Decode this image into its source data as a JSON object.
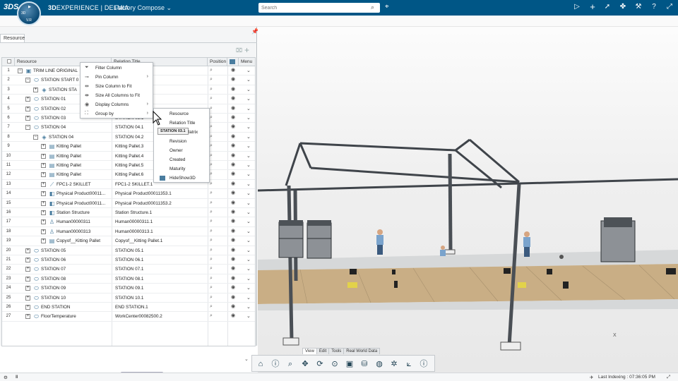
{
  "topbar": {
    "logo": "3DS",
    "compass_v": "V",
    "compass_r": "R",
    "compass_3d": "3D",
    "brand_prefix": "3D",
    "brand_main": "EXPERIENCE | DELMIA",
    "app_title": "Factory Compose",
    "search_placeholder": "Search",
    "icons": [
      "play-icon",
      "add-icon",
      "share-icon",
      "network-icon",
      "tools-icon",
      "help-icon",
      "expand-icon"
    ]
  },
  "panel": {
    "tab_label": "Resource",
    "columns": [
      "Resource",
      "Relation Title",
      "Position",
      "Menu"
    ],
    "rows": [
      {
        "n": "1",
        "name": "TRIM LINE ORIGINAL",
        "rel": "",
        "lvl": 0,
        "exp": "-",
        "icon": "line"
      },
      {
        "n": "2",
        "name": "STATION START 0",
        "rel": "",
        "lvl": 1,
        "exp": "-",
        "icon": "station"
      },
      {
        "n": "3",
        "name": "STATION STA",
        "rel": "",
        "lvl": 2,
        "exp": "+",
        "icon": "cube"
      },
      {
        "n": "4",
        "name": "STATION 01",
        "rel": "",
        "lvl": 1,
        "exp": "+",
        "icon": "station"
      },
      {
        "n": "5",
        "name": "STATION 02",
        "rel": "",
        "lvl": 1,
        "exp": "+",
        "icon": "station"
      },
      {
        "n": "6",
        "name": "STATION 03",
        "rel": "STATION 03.1",
        "lvl": 1,
        "exp": "+",
        "icon": "station"
      },
      {
        "n": "7",
        "name": "STATION 04",
        "rel": "STATION 04.1",
        "lvl": 1,
        "exp": "-",
        "icon": "station"
      },
      {
        "n": "8",
        "name": "STATION 04",
        "rel": "STATION 04.2",
        "lvl": 2,
        "exp": "-",
        "icon": "cube"
      },
      {
        "n": "9",
        "name": "Kitting Pallet",
        "rel": "Kitting Pallet.3",
        "lvl": 3,
        "exp": "+",
        "icon": "pallet"
      },
      {
        "n": "10",
        "name": "Kitting Pallet",
        "rel": "Kitting Pallet.4",
        "lvl": 3,
        "exp": "+",
        "icon": "pallet"
      },
      {
        "n": "11",
        "name": "Kitting Pallet",
        "rel": "Kitting Pallet.5",
        "lvl": 3,
        "exp": "+",
        "icon": "pallet"
      },
      {
        "n": "12",
        "name": "Kitting Pallet",
        "rel": "Kitting Pallet.6",
        "lvl": 3,
        "exp": "+",
        "icon": "pallet"
      },
      {
        "n": "13",
        "name": "FPC1-2 SKILLET",
        "rel": "FPC1-2 SKILLET.1",
        "lvl": 3,
        "exp": "+",
        "icon": "tool"
      },
      {
        "n": "14",
        "name": "Physical Product00011...",
        "rel": "Physical Product00011353.1",
        "lvl": 3,
        "exp": "+",
        "icon": "product"
      },
      {
        "n": "15",
        "name": "Physical Product00011...",
        "rel": "Physical Product00011353.2",
        "lvl": 3,
        "exp": "+",
        "icon": "product"
      },
      {
        "n": "16",
        "name": "Station Structure",
        "rel": "Station Structure.1",
        "lvl": 3,
        "exp": "+",
        "icon": "product"
      },
      {
        "n": "17",
        "name": "Human00000311",
        "rel": "Human00000311.1",
        "lvl": 3,
        "exp": "+",
        "icon": "human"
      },
      {
        "n": "18",
        "name": "Human00000313",
        "rel": "Human00000313.1",
        "lvl": 3,
        "exp": "+",
        "icon": "human"
      },
      {
        "n": "19",
        "name": "Copyof__Kitting Pallet",
        "rel": "Copyof__Kitting Pallet.1",
        "lvl": 3,
        "exp": "+",
        "icon": "pallet"
      },
      {
        "n": "20",
        "name": "STATION 05",
        "rel": "STATION 05.1",
        "lvl": 1,
        "exp": "+",
        "icon": "station"
      },
      {
        "n": "21",
        "name": "STATION 06",
        "rel": "STATION 06.1",
        "lvl": 1,
        "exp": "+",
        "icon": "station"
      },
      {
        "n": "22",
        "name": "STATION 07",
        "rel": "STATION 07.1",
        "lvl": 1,
        "exp": "+",
        "icon": "station"
      },
      {
        "n": "23",
        "name": "STATION 08",
        "rel": "STATION 08.1",
        "lvl": 1,
        "exp": "+",
        "icon": "station"
      },
      {
        "n": "24",
        "name": "STATION 09",
        "rel": "STATION 09.1",
        "lvl": 1,
        "exp": "+",
        "icon": "station"
      },
      {
        "n": "25",
        "name": "STATION 10",
        "rel": "STATION 10.1",
        "lvl": 1,
        "exp": "+",
        "icon": "station"
      },
      {
        "n": "26",
        "name": "END STATION",
        "rel": "END STATION.1",
        "lvl": 1,
        "exp": "+",
        "icon": "station"
      },
      {
        "n": "27",
        "name": "FloorTemperature",
        "rel": "WorkCenter00082500.2",
        "lvl": 1,
        "exp": "+",
        "icon": "station"
      }
    ]
  },
  "context_menu": {
    "items": [
      {
        "label": "Filter Column",
        "icon": "filter-icon",
        "sub": false
      },
      {
        "label": "Pin Column",
        "icon": "pin-icon",
        "sub": true
      },
      {
        "label": "Size Column to Fit",
        "icon": "size-column-icon",
        "sub": false
      },
      {
        "label": "Size All Columns to Fit",
        "icon": "size-all-icon",
        "sub": false
      },
      {
        "label": "Display Columns",
        "icon": "eye-icon",
        "sub": true
      },
      {
        "label": "Group by",
        "icon": "group-icon",
        "sub": true
      }
    ]
  },
  "submenu": {
    "items": [
      "Resource",
      "Relation Title",
      "Matrix",
      "Revision",
      "Owner",
      "Created",
      "Maturity",
      "HideShow3D"
    ]
  },
  "tooltip": "STATION 03.1",
  "viewport": {
    "tabs": [
      "View",
      "Edit",
      "Tools",
      "Real World Data"
    ],
    "active_tab": "View",
    "axis_label": "X",
    "actions": [
      "home-icon",
      "info-icon",
      "zoom-icon",
      "pan-icon",
      "rotate-icon",
      "fit-icon",
      "cube-icon",
      "cylinder-icon",
      "render-icon",
      "scene-icon",
      "measure-icon",
      "help-circle-icon"
    ]
  },
  "status": {
    "last_indexing": "Last Indexing : 07:36:05 PM"
  },
  "colors": {
    "topbar": "#005686",
    "floor": "#c9ae85",
    "walkway": "#d9dadb",
    "steel": "#4a4f55"
  }
}
